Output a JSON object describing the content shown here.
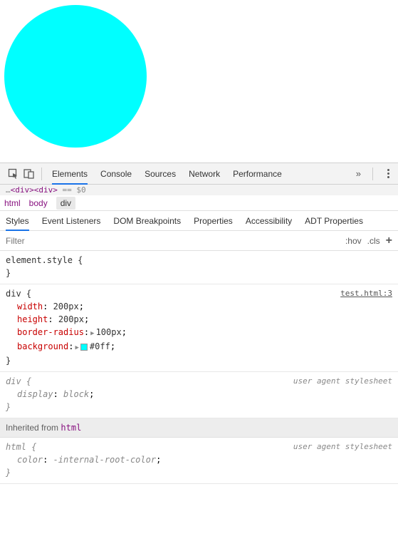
{
  "preview": {
    "circle_color": "#00ffff"
  },
  "toolbar": {
    "tabs": [
      "Elements",
      "Console",
      "Sources",
      "Network",
      "Performance"
    ]
  },
  "dom_line": {
    "prefix": "…",
    "tags": "<div><div>",
    "suffix": " == $0"
  },
  "breadcrumb": {
    "items": [
      "html",
      "body",
      "div"
    ],
    "selected": 2
  },
  "sub_tabs": {
    "items": [
      "Styles",
      "Event Listeners",
      "DOM Breakpoints",
      "Properties",
      "Accessibility",
      "ADT Properties"
    ],
    "active": 0
  },
  "filter": {
    "placeholder": "Filter",
    "hov": ":hov",
    "cls": ".cls"
  },
  "styles": {
    "element_style": {
      "selector": "element.style",
      "props": []
    },
    "div_rule": {
      "selector": "div",
      "source": "test.html:3",
      "props": [
        {
          "name": "width",
          "value": "200px"
        },
        {
          "name": "height",
          "value": "200px"
        },
        {
          "name": "border-radius",
          "value": "100px",
          "expandable": true
        },
        {
          "name": "background",
          "value": "#0ff",
          "expandable": true,
          "swatch": "#00ffff"
        }
      ]
    },
    "ua_div": {
      "selector": "div",
      "label": "user agent stylesheet",
      "props": [
        {
          "name": "display",
          "value": "block"
        }
      ]
    },
    "inherited_label": "Inherited from",
    "inherited_tag": "html",
    "ua_html": {
      "selector": "html",
      "label": "user agent stylesheet",
      "props": [
        {
          "name": "color",
          "value": "-internal-root-color"
        }
      ]
    }
  }
}
